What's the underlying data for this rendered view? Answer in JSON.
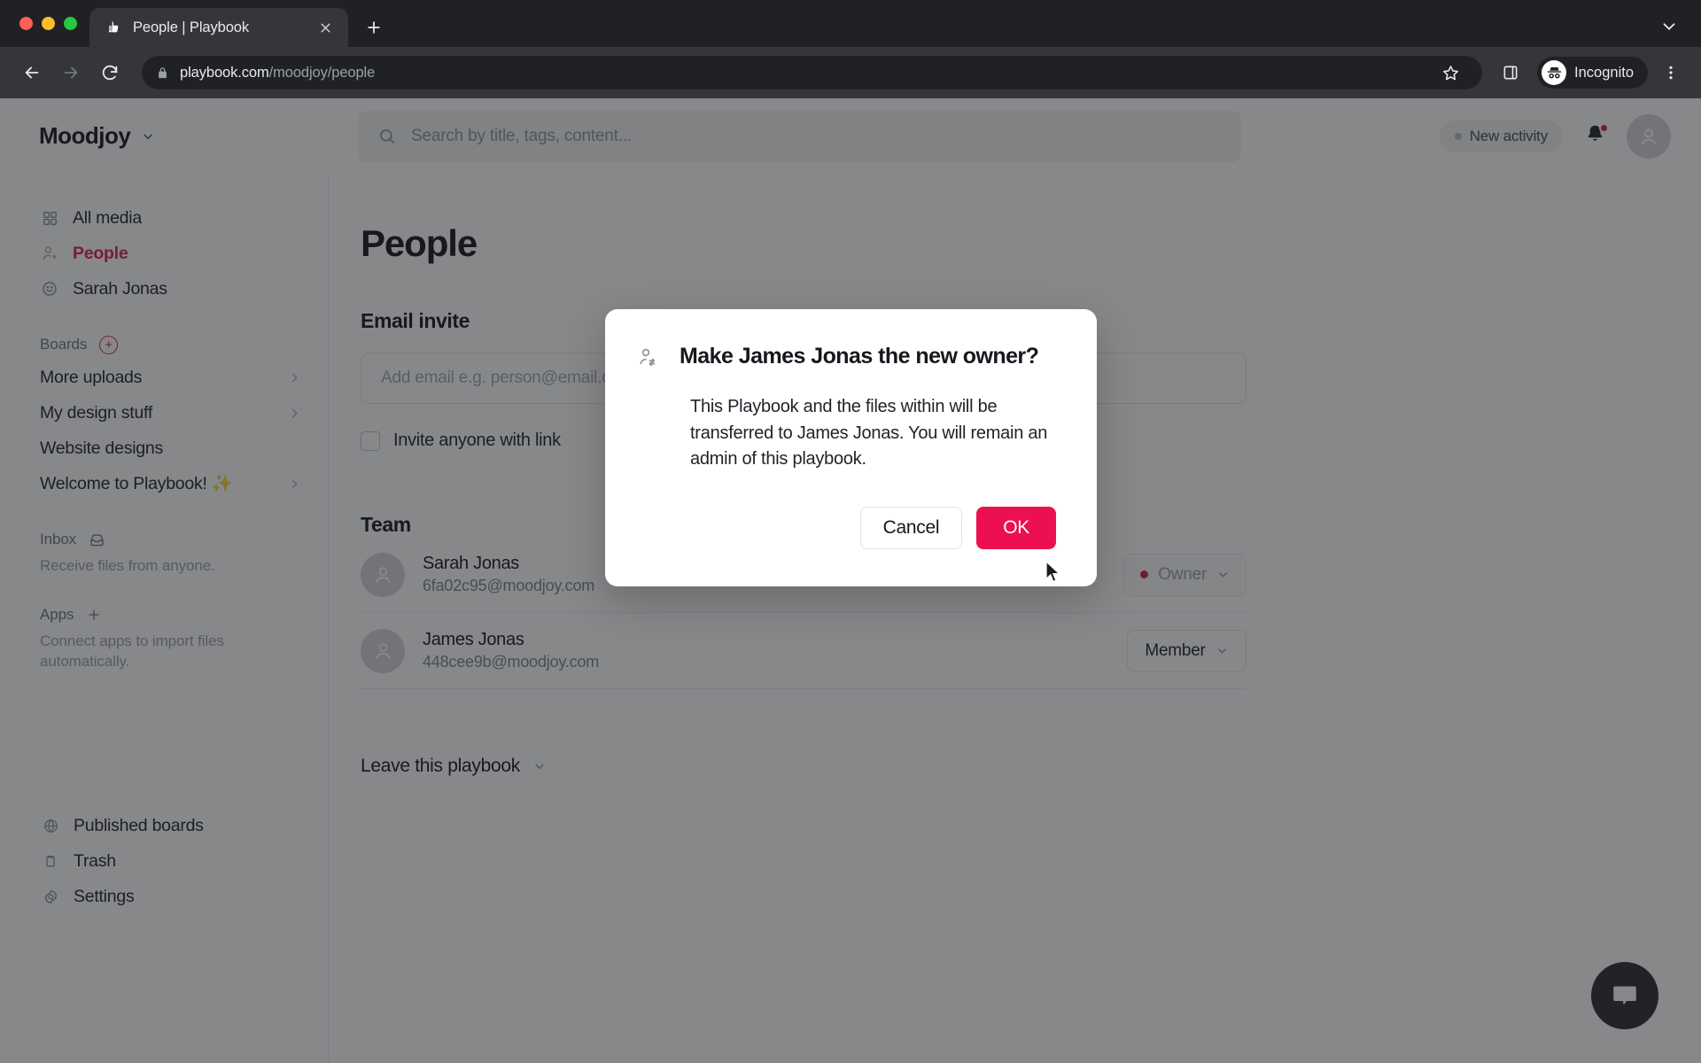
{
  "browser": {
    "tab": {
      "title": "People | Playbook",
      "favicon": "hand-thumbsup-icon",
      "close": "close-icon"
    },
    "new_tab_label": "+",
    "collapse_icon": "chevron-down-icon",
    "nav": {
      "back": "back-arrow-icon",
      "forward": "forward-arrow-icon",
      "reload": "reload-icon"
    },
    "omnibox": {
      "lock_icon": "lock-icon",
      "url_domain": "playbook.com",
      "url_path": "/moodjoy/people",
      "star_icon": "star-icon",
      "sidepanel_icon": "side-panel-icon"
    },
    "incognito": {
      "label": "Incognito",
      "icon": "incognito-hat-icon"
    },
    "menu_icon": "kebab-menu-icon"
  },
  "header": {
    "brand": "Moodjoy",
    "brand_chevron": "chevron-down-icon",
    "search": {
      "placeholder": "Search by title, tags, content...",
      "icon": "search-icon"
    },
    "activity_chip": "New activity",
    "bell_icon": "bell-icon",
    "bell_has_badge": true,
    "avatar": "user-avatar-icon"
  },
  "sidebar": {
    "nav": [
      {
        "label": "All media",
        "icon": "grid-icon",
        "active": false,
        "chevron": false
      },
      {
        "label": "People",
        "icon": "person-add-icon",
        "active": true,
        "chevron": false
      },
      {
        "label": "Sarah Jonas",
        "icon": "smiley-icon",
        "active": false,
        "chevron": false
      }
    ],
    "boards_section": {
      "label": "Boards",
      "add_icon": "plus-circle-icon"
    },
    "boards": [
      {
        "label": "More uploads",
        "chevron": true
      },
      {
        "label": "My design stuff",
        "chevron": true
      },
      {
        "label": "Website designs",
        "chevron": false
      },
      {
        "label": "Welcome to Playbook! ✨",
        "chevron": true
      }
    ],
    "inbox_section": {
      "label": "Inbox",
      "icon": "inbox-tray-icon",
      "note": "Receive files from anyone."
    },
    "apps_section": {
      "label": "Apps",
      "icon": "plus-icon",
      "note": "Connect apps to import files automatically."
    },
    "bottom": [
      {
        "label": "Published boards",
        "icon": "globe-icon"
      },
      {
        "label": "Trash",
        "icon": "trash-icon"
      },
      {
        "label": "Settings",
        "icon": "gear-icon"
      }
    ]
  },
  "main": {
    "title": "People",
    "email_invite": {
      "label": "Email invite",
      "placeholder": "Add email e.g. person@email.com",
      "value": ""
    },
    "invite_link": {
      "label": "Invite anyone with link",
      "checked": false
    },
    "team": {
      "label": "Team",
      "members": [
        {
          "name": "Sarah Jonas",
          "email": "6fa02c95@moodjoy.com",
          "role": "Owner",
          "role_muted": true,
          "role_dot": true,
          "role_dot_color": "#c2243f"
        },
        {
          "name": "James Jonas",
          "email": "448cee9b@moodjoy.com",
          "role": "Member",
          "role_muted": false,
          "role_dot": false
        }
      ]
    },
    "leave": {
      "label": "Leave this playbook",
      "chevron": "chevron-down-icon"
    },
    "chat_fab": "chat-bubble-icon"
  },
  "modal": {
    "icon": "person-switch-icon",
    "title": "Make James Jonas the new owner?",
    "body": "This Playbook and the files within will be transferred to James Jonas. You will remain an admin of this playbook.",
    "cancel_label": "Cancel",
    "ok_label": "OK"
  },
  "colors": {
    "accent_pink": "#ec1051",
    "active_nav": "#d8234d",
    "chrome_dark": "#202124",
    "chrome_tab": "#35363a",
    "text_primary": "#15181c",
    "text_muted": "#7e848a"
  }
}
